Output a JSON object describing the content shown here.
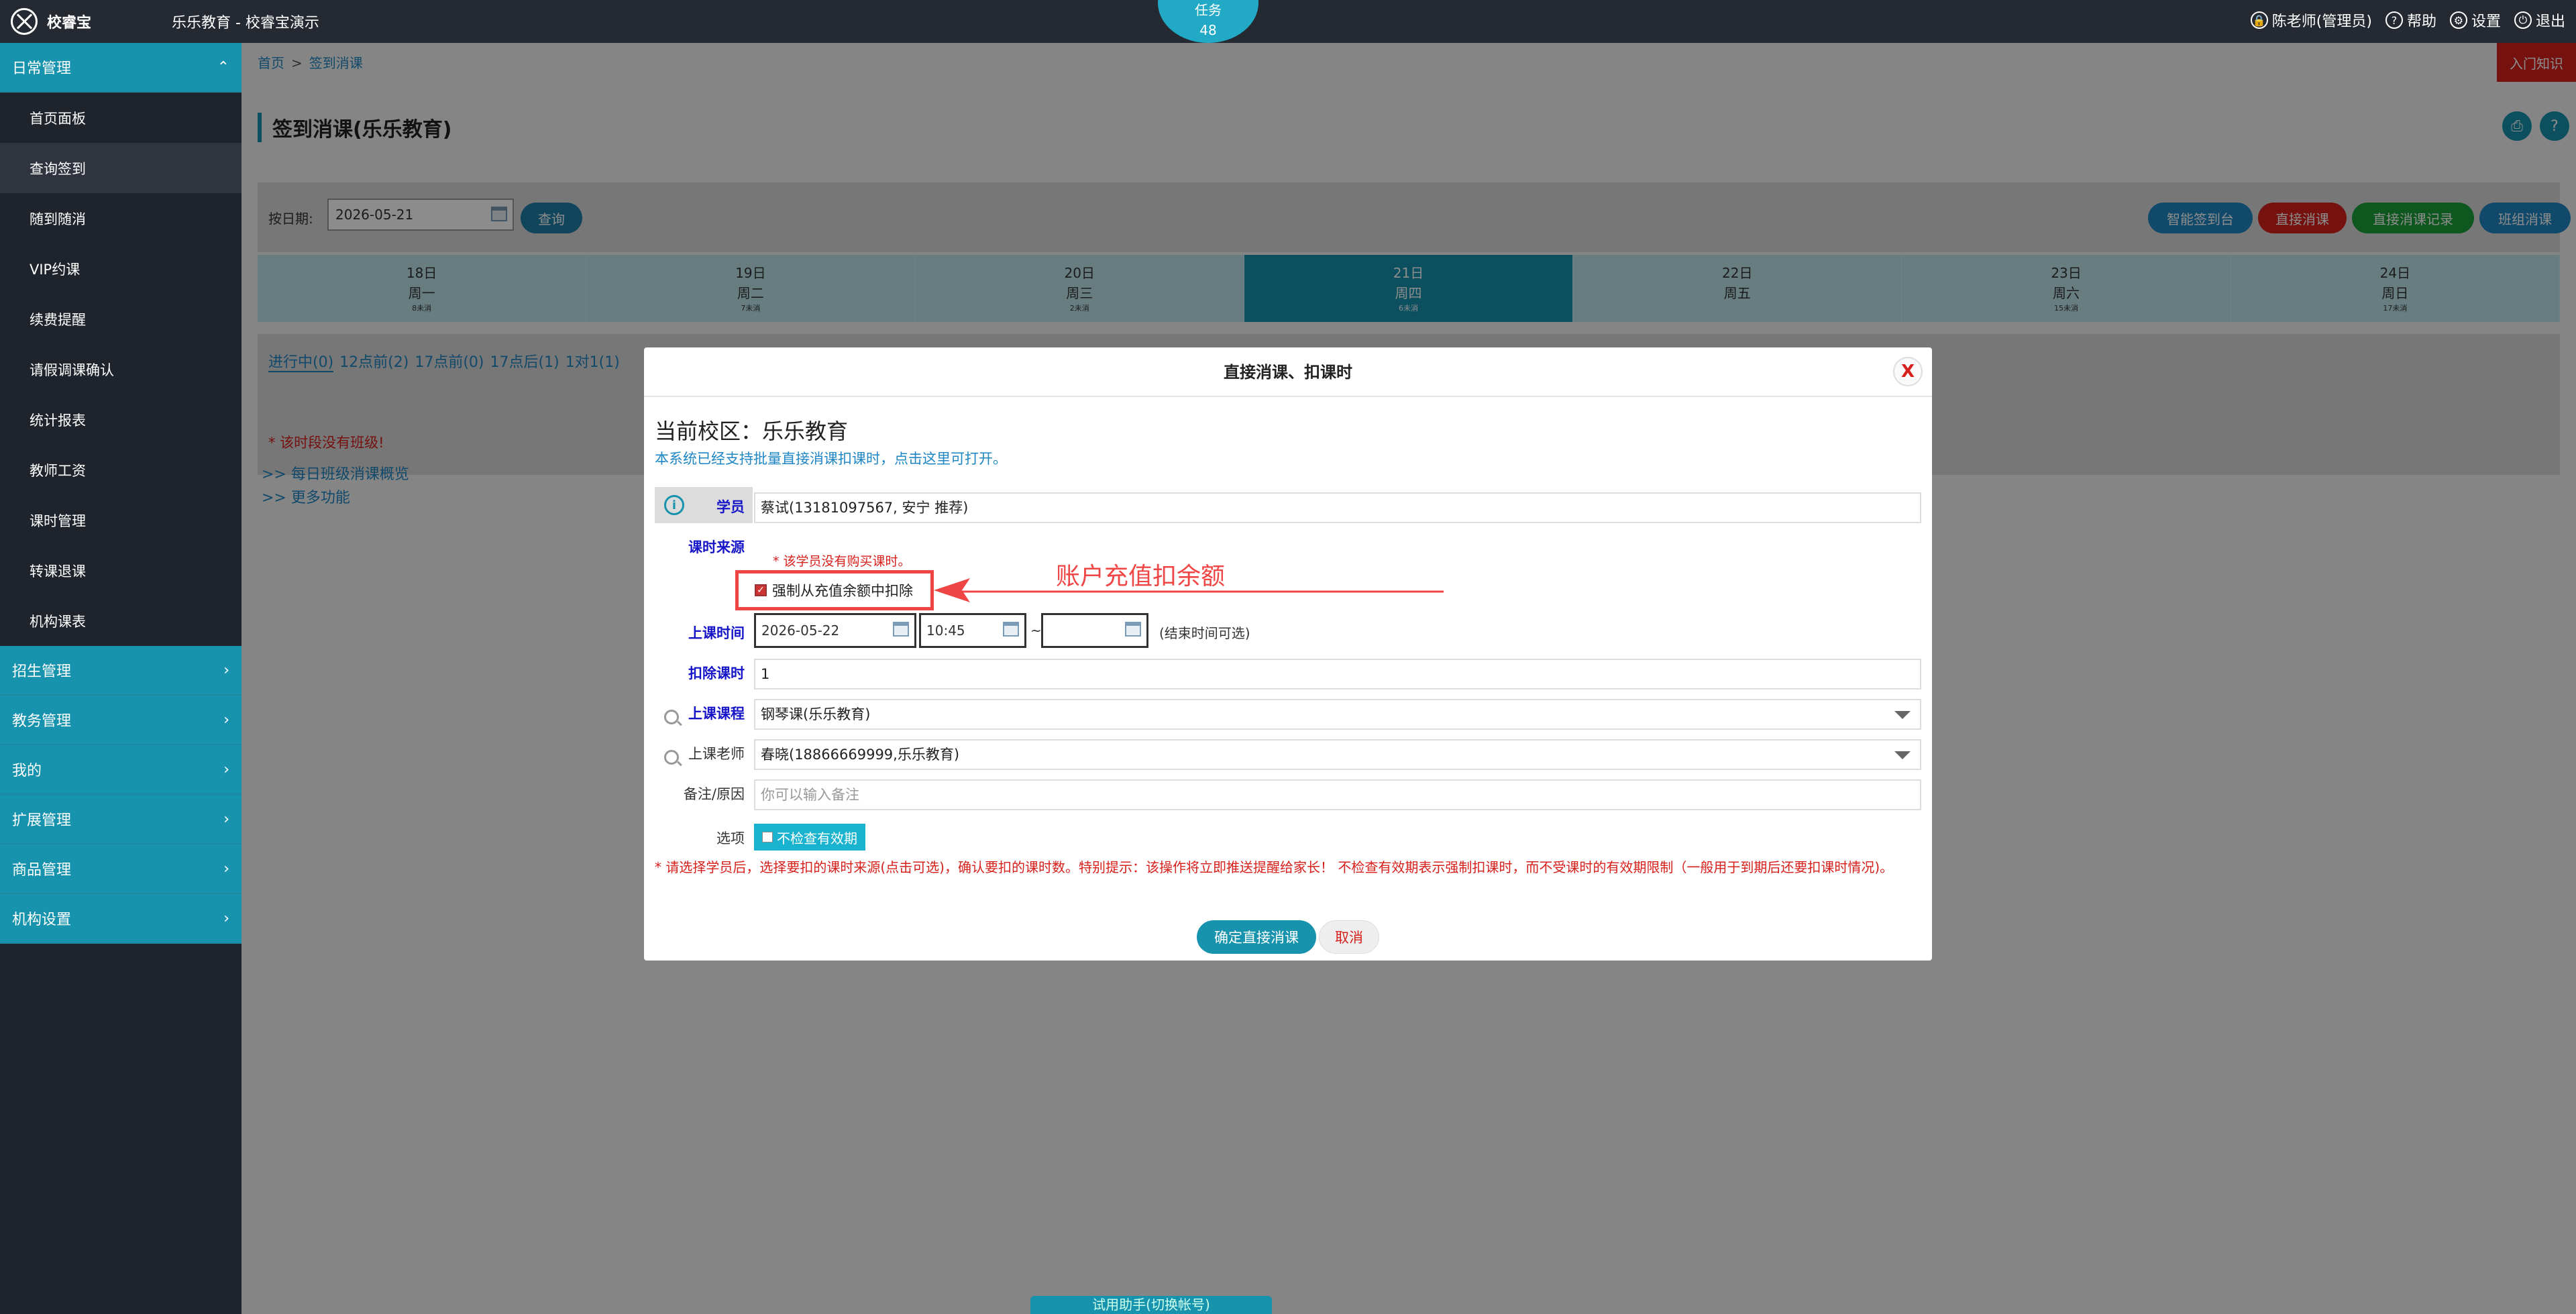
{
  "topbar": {
    "brand": "校睿宝",
    "app_title": "乐乐教育 - 校睿宝演示",
    "task_label": "任务",
    "task_count": "48",
    "user": "陈老师(管理员)",
    "help": "帮助",
    "settings": "设置",
    "logout": "退出"
  },
  "sidebar": {
    "groups_top": "日常管理",
    "items": [
      "首页面板",
      "查询签到",
      "随到随消",
      "VIP约课",
      "续费提醒",
      "请假调课确认",
      "统计报表",
      "教师工资",
      "课时管理",
      "转课退课",
      "机构课表"
    ],
    "groups": [
      "招生管理",
      "教务管理",
      "我的",
      "扩展管理",
      "商品管理",
      "机构设置"
    ]
  },
  "main": {
    "breadcrumb_home": "首页",
    "breadcrumb_sep": ">",
    "breadcrumb_current": "签到消课",
    "intro_button": "入门知识",
    "page_title": "签到消课(乐乐教育)",
    "filter_label": "按日期:",
    "filter_date": "2026-05-21",
    "query_button": "查询",
    "actions": [
      "智能签到台",
      "直接消课",
      "直接消课记录",
      "班组消课"
    ],
    "days": [
      {
        "date": "18日",
        "weekday": "周一",
        "count": "8未消"
      },
      {
        "date": "19日",
        "weekday": "周二",
        "count": "7未消"
      },
      {
        "date": "20日",
        "weekday": "周三",
        "count": "2未消"
      },
      {
        "date": "21日",
        "weekday": "周四",
        "count": "6未消"
      },
      {
        "date": "22日",
        "weekday": "周五",
        "count": ""
      },
      {
        "date": "23日",
        "weekday": "周六",
        "count": "15未消"
      },
      {
        "date": "24日",
        "weekday": "周日",
        "count": "17未消"
      }
    ],
    "tabs": [
      "进行中(0)",
      "12点前(2)",
      "17点前(0)",
      "17点后(1)",
      "1对1(1)"
    ],
    "no_class": "* 该时段没有班级!",
    "link_overview": ">> 每日班级消课概览",
    "link_more": ">> 更多功能",
    "bottom_tab": "试用助手(切换帐号)"
  },
  "modal": {
    "title": "直接消课、扣课时",
    "close": "X",
    "campus": "当前校区：乐乐教育",
    "batch_note": "本系统已经支持批量直接消课扣课时，点击这里可打开。",
    "student_label": "学员",
    "student_value": "蔡试(13181097567, 安宁 推荐)",
    "source_label": "课时来源",
    "source_warning": "* 该学员没有购买课时。",
    "force_deduct": "强制从充值余额中扣除",
    "annotation": "账户充值扣余额",
    "time_label": "上课时间",
    "date_value": "2026-05-22",
    "start_time": "10:45",
    "time_sep": "~",
    "end_time": "",
    "end_hint": "(结束时间可选)",
    "hours_label": "扣除课时",
    "hours_value": "1",
    "course_label": "上课课程",
    "course_value": "钢琴课(乐乐教育)",
    "teacher_label": "上课老师",
    "teacher_value": "春晓(18866669999,乐乐教育)",
    "remark_label": "备注/原因",
    "remark_placeholder": "你可以输入备注",
    "option_label": "选项",
    "option_value": "不检查有效期",
    "tip": "* 请选择学员后，选择要扣的课时来源(点击可选)，确认要扣的课时数。特别提示：该操作将立即推送提醒给家长！ 不检查有效期表示强制扣课时，而不受课时的有效期限制（一般用于到期后还要扣课时情况)。",
    "confirm_button": "确定直接消课",
    "cancel_button": "取消"
  },
  "colors": {
    "accent": "#1793ad",
    "danger": "#d6201c",
    "link": "#1f86c4",
    "annotation": "#f04545",
    "sidebar_bg": "#1f232b",
    "topbar_bg": "#252932"
  }
}
